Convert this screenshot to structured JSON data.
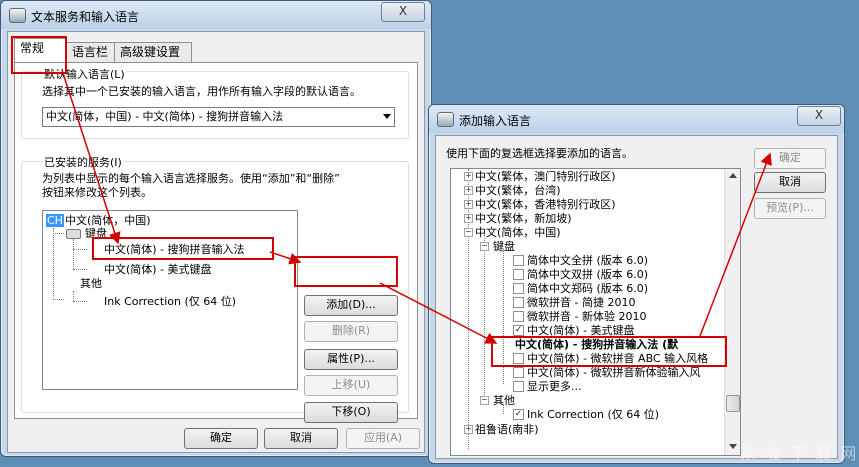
{
  "colors": {
    "desktop": "#5d8fb6",
    "highlight": "#d40000",
    "selection": "#3399ff"
  },
  "dialog1": {
    "title": "文本服务和输入语言",
    "close": "X",
    "tabs": [
      "常规",
      "语言栏",
      "高级键设置"
    ],
    "default_lang": {
      "legend": "默认输入语言(L)",
      "desc": "选择其中一个已安装的输入语言，用作所有输入字段的默认语言。",
      "selected": "中文(简体，中国) - 中文(简体) - 搜狗拼音输入法"
    },
    "installed": {
      "legend": "已安装的服务(I)",
      "desc1": "为列表中显示的每个输入语言选择服务。使用“添加”和“删除”",
      "desc2": "按钮来修改这个列表。",
      "tree": {
        "badge": "CH",
        "lang": "中文(简体，中国)",
        "keyboard": "键盘",
        "kb_items": [
          "中文(简体) - 搜狗拼音输入法",
          "中文(简体) - 美式键盘"
        ],
        "other": "其他",
        "other_items": [
          "Ink Correction (仅 64 位)"
        ]
      }
    },
    "buttons": {
      "add": "添加(D)...",
      "remove": "删除(R)",
      "props": "属性(P)...",
      "up": "上移(U)",
      "down": "下移(O)"
    },
    "footer": {
      "ok": "确定",
      "cancel": "取消",
      "apply": "应用(A)"
    }
  },
  "dialog2": {
    "title": "添加输入语言",
    "close": "X",
    "prompt": "使用下面的复选框选择要添加的语言。",
    "buttons": {
      "ok": "确定",
      "cancel": "取消",
      "preview": "预览(P)..."
    },
    "tree": {
      "langs_above": [
        "中文(繁体，澳门特别行政区)",
        "中文(繁体，台湾)",
        "中文(繁体，香港特别行政区)",
        "中文(繁体，新加坡)"
      ],
      "current": "中文(简体，中国)",
      "keyboard": "键盘",
      "kb_items": [
        {
          "label": "简体中文全拼 (版本 6.0)",
          "checked": false
        },
        {
          "label": "简体中文双拼 (版本 6.0)",
          "checked": false
        },
        {
          "label": "简体中文郑码 (版本 6.0)",
          "checked": false
        },
        {
          "label": "微软拼音 - 简捷 2010",
          "checked": false
        },
        {
          "label": "微软拼音 - 新体验 2010",
          "checked": false
        },
        {
          "label": "中文(简体) - 美式键盘",
          "checked": true
        },
        {
          "label": "中文(简体) - 搜狗拼音输入法 (默",
          "checked": true
        },
        {
          "label": "中文(简体) - 微软拼音 ABC 输入风格",
          "checked": false
        },
        {
          "label": "中文(简体) - 微软拼音新体验输入风",
          "checked": false
        }
      ],
      "more": "显示更多...",
      "other": "其他",
      "other_items": [
        {
          "label": "Ink Correction (仅 64 位)",
          "checked": true
        }
      ],
      "last_lang": "祖鲁语(南非)"
    }
  },
  "watermark": "东 坡 下 载 网"
}
